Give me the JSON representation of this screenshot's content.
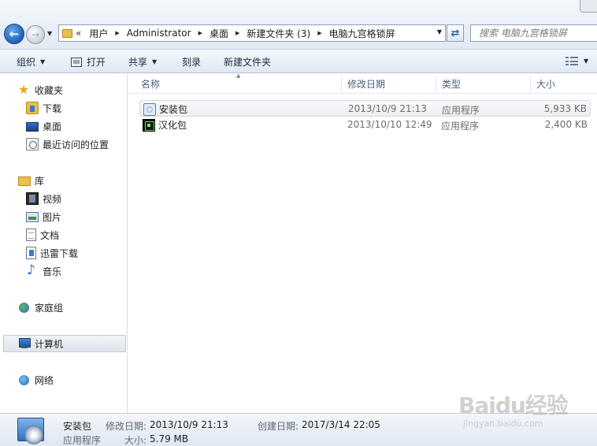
{
  "address": {
    "prefix": "«",
    "crumbs": [
      "用户",
      "Administrator",
      "桌面",
      "新建文件夹 (3)",
      "电脑九宫格锁屏"
    ]
  },
  "search": {
    "placeholder": "搜索 电脑九宫格锁屏"
  },
  "toolbar": {
    "organize": "组织",
    "open": "打开",
    "share": "共享",
    "burn": "刻录",
    "new_folder": "新建文件夹"
  },
  "nav": {
    "favorites": "收藏夹",
    "downloads": "下载",
    "desktop": "桌面",
    "recent": "最近访问的位置",
    "libraries": "库",
    "videos": "视频",
    "pictures": "图片",
    "documents": "文档",
    "thunder": "迅雷下载",
    "music": "音乐",
    "homegroup": "家庭组",
    "computer": "计算机",
    "network": "网络"
  },
  "columns": {
    "name": "名称",
    "modified": "修改日期",
    "type": "类型",
    "size": "大小"
  },
  "files": [
    {
      "name": "安装包",
      "modified": "2013/10/9 21:13",
      "type": "应用程序",
      "size": "5,933 KB"
    },
    {
      "name": "汉化包",
      "modified": "2013/10/10 12:49",
      "type": "应用程序",
      "size": "2,400 KB"
    }
  ],
  "details": {
    "name": "安装包",
    "type": "应用程序",
    "modified_label": "修改日期:",
    "modified": "2013/10/9 21:13",
    "created_label": "创建日期:",
    "created": "2017/3/14 22:05",
    "size_label": "大小:",
    "size": "5.79 MB"
  },
  "watermark": {
    "main": "Baidu经验",
    "sub": "jingyan.baidu.com"
  }
}
